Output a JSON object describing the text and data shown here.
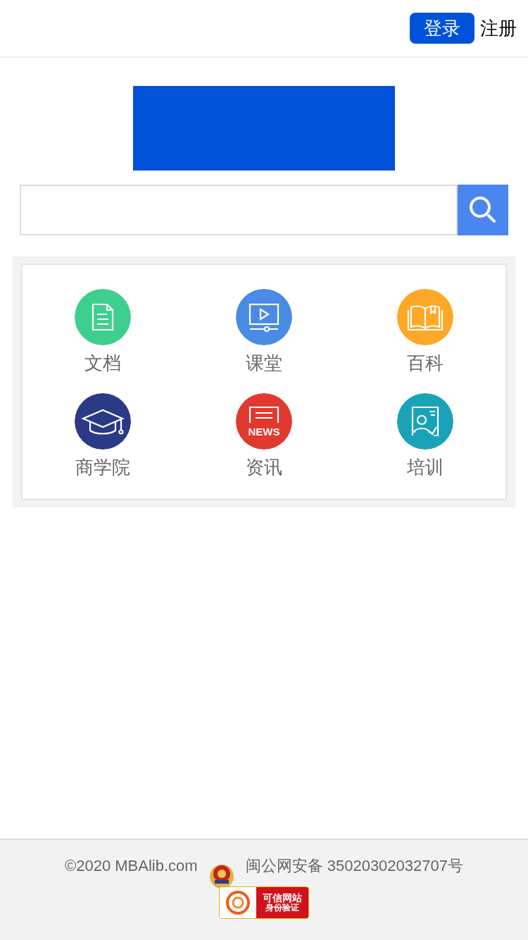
{
  "header": {
    "login_button": "登录",
    "register_link": "注册"
  },
  "categories": [
    {
      "label": "文档",
      "kind": "document",
      "color": "#3ecf8e"
    },
    {
      "label": "课堂",
      "kind": "video",
      "color": "#4a8be6"
    },
    {
      "label": "百科",
      "kind": "book",
      "color": "#ffa726"
    },
    {
      "label": "商学院",
      "kind": "cap",
      "color": "#2b3a86"
    },
    {
      "label": "资讯",
      "kind": "news",
      "color": "#e0392e",
      "icon_text": "NEWS"
    },
    {
      "label": "培训",
      "kind": "training",
      "color": "#1aa3b8"
    }
  ],
  "footer": {
    "copyright": "©2020 MBAlib.com",
    "record": "闽公网安备 35020302032707号",
    "badge_title": "可信网站",
    "badge_subtitle": "身份验证"
  }
}
